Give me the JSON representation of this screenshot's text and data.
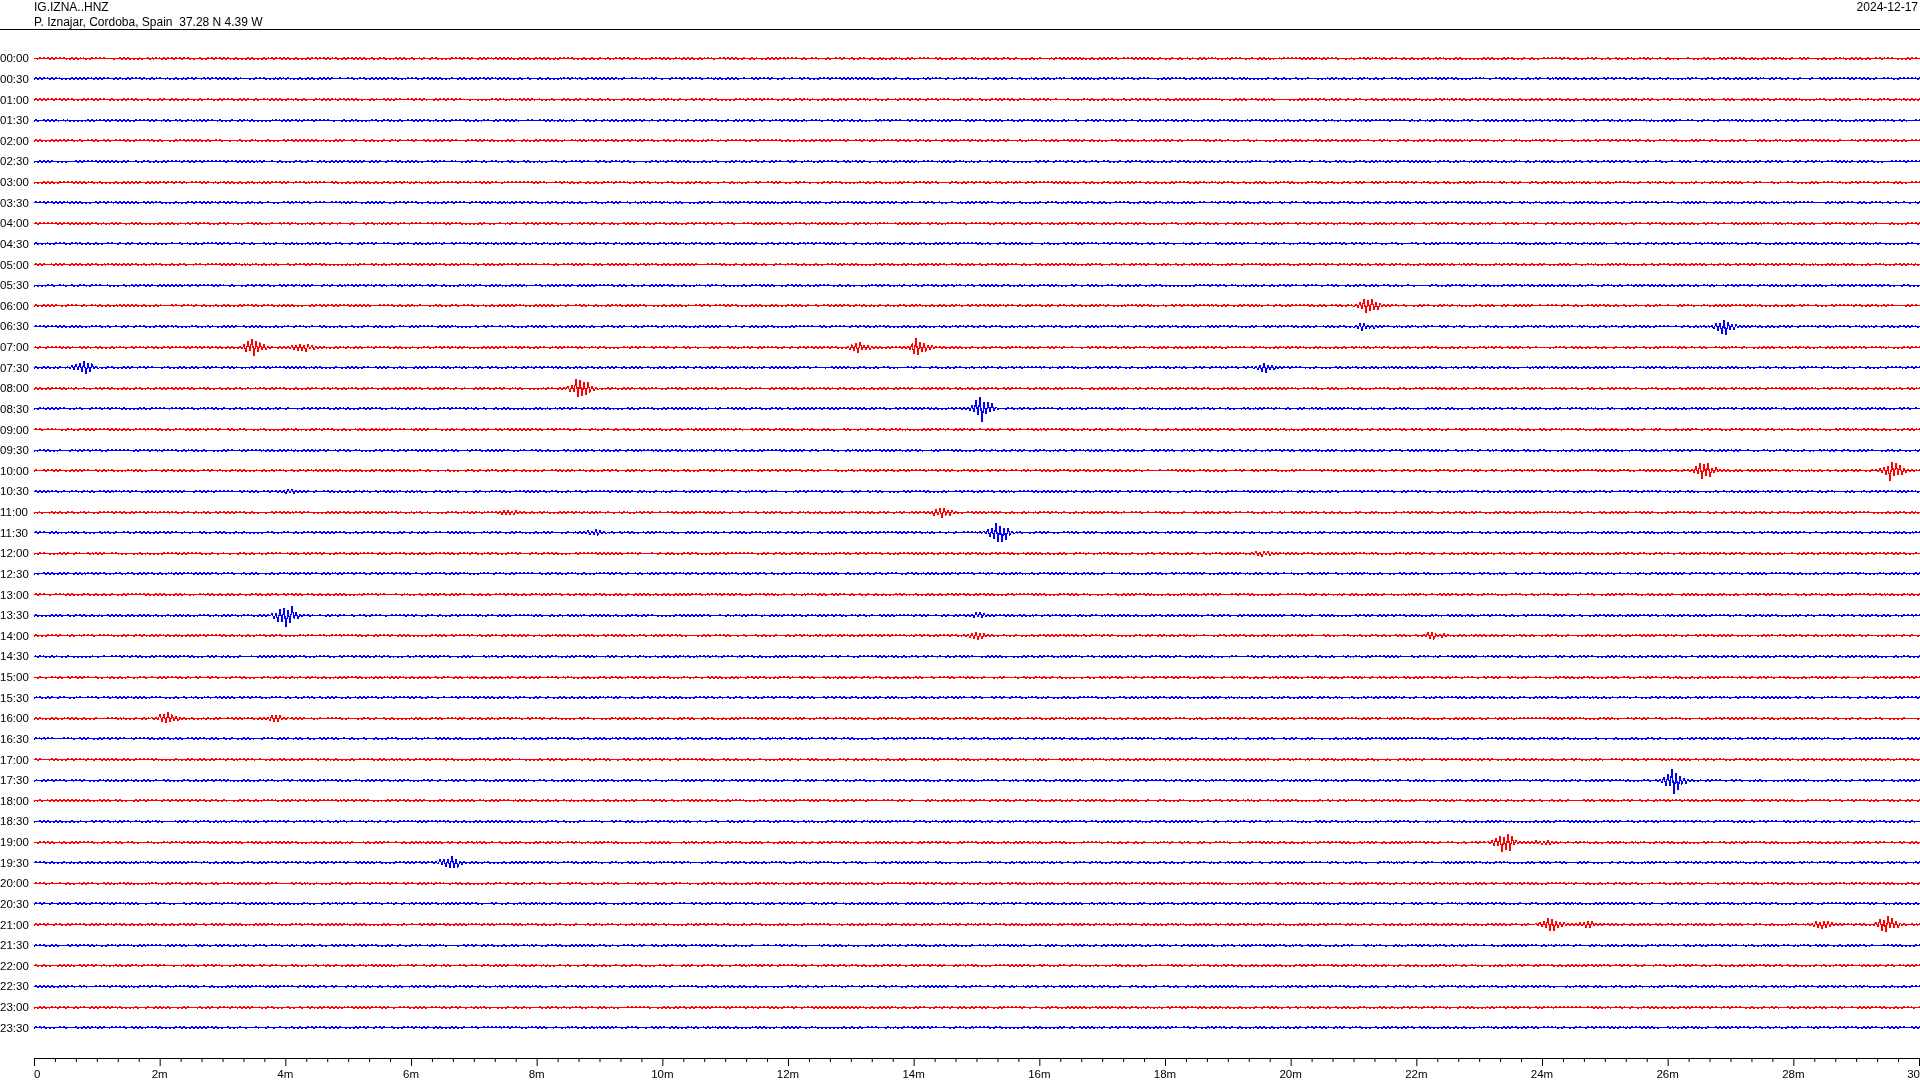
{
  "header": {
    "station": "IG.IZNA..HNZ",
    "location": "P. Iznajar, Cordoba, Spain  37.28 N 4.39 W",
    "date": "2024-12-17"
  },
  "traces": [
    {
      "label": "00:00",
      "color": "#ff0000"
    },
    {
      "label": "00:30",
      "color": "#0000ff"
    },
    {
      "label": "01:00",
      "color": "#ff0000"
    },
    {
      "label": "01:30",
      "color": "#0000ff"
    },
    {
      "label": "02:00",
      "color": "#ff0000"
    },
    {
      "label": "02:30",
      "color": "#0000ff"
    },
    {
      "label": "03:00",
      "color": "#ff0000"
    },
    {
      "label": "03:30",
      "color": "#0000ff"
    },
    {
      "label": "04:00",
      "color": "#ff0000"
    },
    {
      "label": "04:30",
      "color": "#0000ff"
    },
    {
      "label": "05:00",
      "color": "#ff0000"
    },
    {
      "label": "05:30",
      "color": "#0000ff"
    },
    {
      "label": "06:00",
      "color": "#ff0000"
    },
    {
      "label": "06:30",
      "color": "#0000ff"
    },
    {
      "label": "07:00",
      "color": "#ff0000"
    },
    {
      "label": "07:30",
      "color": "#0000ff"
    },
    {
      "label": "08:00",
      "color": "#ff0000"
    },
    {
      "label": "08:30",
      "color": "#0000ff"
    },
    {
      "label": "09:00",
      "color": "#ff0000"
    },
    {
      "label": "09:30",
      "color": "#0000ff"
    },
    {
      "label": "10:00",
      "color": "#ff0000"
    },
    {
      "label": "10:30",
      "color": "#0000ff"
    },
    {
      "label": "11:00",
      "color": "#ff0000"
    },
    {
      "label": "11:30",
      "color": "#0000ff"
    },
    {
      "label": "12:00",
      "color": "#ff0000"
    },
    {
      "label": "12:30",
      "color": "#0000ff"
    },
    {
      "label": "13:00",
      "color": "#ff0000"
    },
    {
      "label": "13:30",
      "color": "#0000ff"
    },
    {
      "label": "14:00",
      "color": "#ff0000"
    },
    {
      "label": "14:30",
      "color": "#0000ff"
    },
    {
      "label": "15:00",
      "color": "#ff0000"
    },
    {
      "label": "15:30",
      "color": "#0000ff"
    },
    {
      "label": "16:00",
      "color": "#ff0000"
    },
    {
      "label": "16:30",
      "color": "#0000ff"
    },
    {
      "label": "17:00",
      "color": "#ff0000"
    },
    {
      "label": "17:30",
      "color": "#0000ff"
    },
    {
      "label": "18:00",
      "color": "#ff0000"
    },
    {
      "label": "18:30",
      "color": "#0000ff"
    },
    {
      "label": "19:00",
      "color": "#ff0000"
    },
    {
      "label": "19:30",
      "color": "#0000ff"
    },
    {
      "label": "20:00",
      "color": "#ff0000"
    },
    {
      "label": "20:30",
      "color": "#0000ff"
    },
    {
      "label": "21:00",
      "color": "#ff0000"
    },
    {
      "label": "21:30",
      "color": "#0000ff"
    },
    {
      "label": "22:00",
      "color": "#ff0000"
    },
    {
      "label": "22:30",
      "color": "#0000ff"
    },
    {
      "label": "23:00",
      "color": "#ff0000"
    },
    {
      "label": "23:30",
      "color": "#0000ff"
    }
  ],
  "time_axis": {
    "ticks": [
      "0",
      "2m",
      "4m",
      "6m",
      "8m",
      "10m",
      "12m",
      "14m",
      "16m",
      "18m",
      "20m",
      "22m",
      "24m",
      "26m",
      "28m",
      "30"
    ]
  }
}
